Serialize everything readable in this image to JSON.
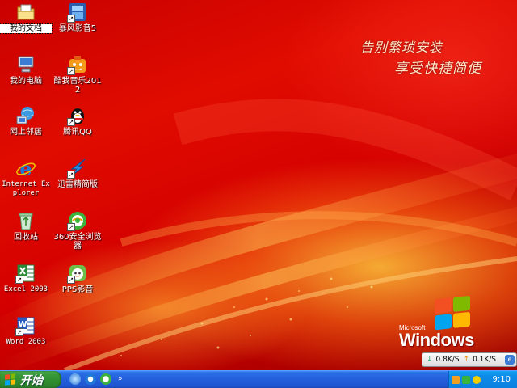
{
  "wallpaper": {
    "slogan_line1": "告别繁琐安装",
    "slogan_line2": "享受快捷简便",
    "logo_small": "Microsoft",
    "logo_big": "Windows"
  },
  "desktop_icons": [
    {
      "label": "我的文档",
      "icon": "my-documents-icon",
      "selected": true
    },
    {
      "label": "暴风影音5",
      "icon": "baofeng-player-icon"
    },
    {
      "label": "我的电脑",
      "icon": "my-computer-icon"
    },
    {
      "label": "酷我音乐2012",
      "icon": "kuwo-music-icon"
    },
    {
      "label": "网上邻居",
      "icon": "network-places-icon"
    },
    {
      "label": "腾讯QQ",
      "icon": "qq-penguin-icon"
    },
    {
      "label": "Internet Explorer",
      "icon": "internet-explorer-icon"
    },
    {
      "label": "迅雷精简版",
      "icon": "thunder-download-icon"
    },
    {
      "label": "回收站",
      "icon": "recycle-bin-icon"
    },
    {
      "label": "360安全浏览器",
      "icon": "360-browser-icon"
    },
    {
      "label": "Excel 2003",
      "icon": "excel-icon"
    },
    {
      "label": "PPS影音",
      "icon": "pps-player-icon"
    },
    {
      "label": "Word 2003",
      "icon": "word-icon"
    }
  ],
  "net_speed": {
    "download": "0.8K/S",
    "upload": "0.1K/S"
  },
  "taskbar": {
    "start_label": "开始",
    "quick_launch": [
      "show-desktop-icon",
      "internet-explorer-icon",
      "360-browser-icon"
    ],
    "more": "»",
    "clock": "9:10"
  },
  "colors": {
    "taskbar_blue": "#245edb",
    "start_green": "#2f8c2f",
    "tray_blue": "#0b80e0",
    "wallpaper_red": "#d40000"
  }
}
